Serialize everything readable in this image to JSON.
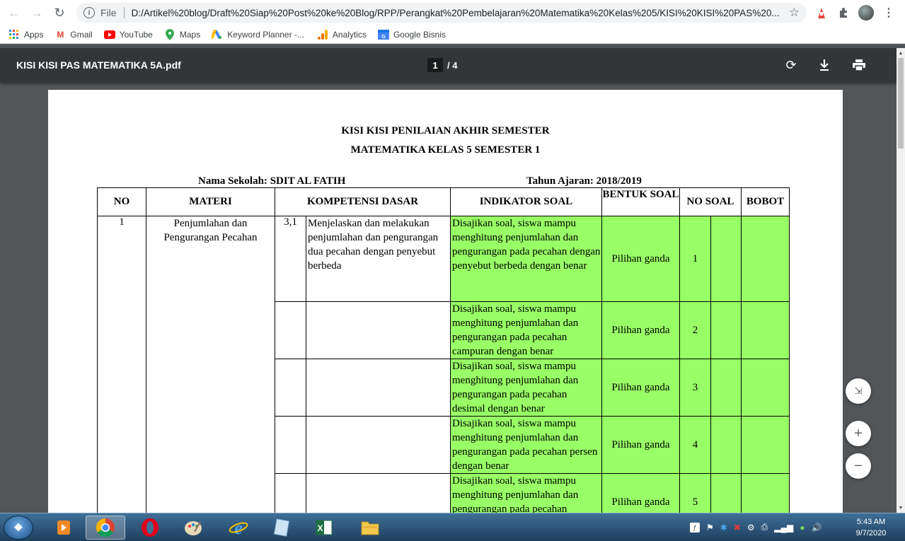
{
  "browser": {
    "scheme": "File",
    "url": "D:/Artikel%20blog/Draft%20Siap%20Post%20ke%20Blog/RPP/Perangkat%20Pembelajaran%20Matematika%20Kelas%205/KISI%20KISI%20PAS%20...",
    "bookmarks": [
      {
        "label": "Apps",
        "icon": "apps-grid-icon"
      },
      {
        "label": "Gmail",
        "icon": "gmail-icon"
      },
      {
        "label": "YouTube",
        "icon": "youtube-icon"
      },
      {
        "label": "Maps",
        "icon": "maps-pin-icon"
      },
      {
        "label": "Keyword Planner -...",
        "icon": "google-ads-icon"
      },
      {
        "label": "Analytics",
        "icon": "analytics-icon"
      },
      {
        "label": "Google Bisnis",
        "icon": "google-business-icon"
      }
    ]
  },
  "pdf": {
    "filename": "KISI KISI PAS MATEMATIKA 5A.pdf",
    "current_page": "1",
    "total_pages": "/ 4"
  },
  "document": {
    "title1": "KISI KISI PENILAIAN AKHIR SEMESTER",
    "title2": "MATEMATIKA KELAS 5 SEMESTER 1",
    "school_label": "Nama Sekolah:",
    "school_value": "SDIT AL FATIH",
    "year_label": "Tahun Ajaran:",
    "year_value": "2018/2019",
    "headers": {
      "no": "NO",
      "materi": "MATERI",
      "kd": "KOMPETENSI DASAR",
      "indikator": "INDIKATOR SOAL",
      "bentuk": "BENTUK SOAL",
      "no_soal": "NO SOAL",
      "bobot": "BOBOT"
    },
    "row_no": "1",
    "materi": "Penjumlahan dan Pengurangan Pecahan",
    "kd_no": "3,1",
    "kd_text": "Menjelaskan dan melakukan penjumlahan dan pengurangan dua pecahan dengan penyebut berbeda",
    "rows": [
      {
        "indikator": "Disajikan soal, siswa mampu menghitung penjumlahan dan pengurangan pada pecahan dengan penyebut berbeda dengan benar",
        "bentuk": "Pilihan ganda",
        "no_soal": "1"
      },
      {
        "indikator": "Disajikan soal, siswa mampu menghitung penjumlahan dan pengurangan pada pecahan campuran dengan benar",
        "bentuk": "Pilihan ganda",
        "no_soal": "2"
      },
      {
        "indikator": "Disajikan soal, siswa mampu menghitung penjumlahan dan pengurangan pada pecahan desimal dengan benar",
        "bentuk": "Pilihan ganda",
        "no_soal": "3"
      },
      {
        "indikator": "Disajikan soal, siswa mampu menghitung penjumlahan dan pengurangan pada pecahan persen dengan benar",
        "bentuk": "Pilihan ganda",
        "no_soal": "4"
      },
      {
        "indikator": "Disajikan soal, siswa mampu menghitung penjumlahan dan pengurangan pada pecahan",
        "bentuk": "Pilihan ganda",
        "no_soal": "5"
      }
    ]
  },
  "taskbar": {
    "time": "5:43 AM",
    "date": "9/7/2020"
  },
  "colors": {
    "highlight": "#99ff66",
    "pdf_toolbar": "#323639",
    "viewer_bg": "#525659"
  }
}
